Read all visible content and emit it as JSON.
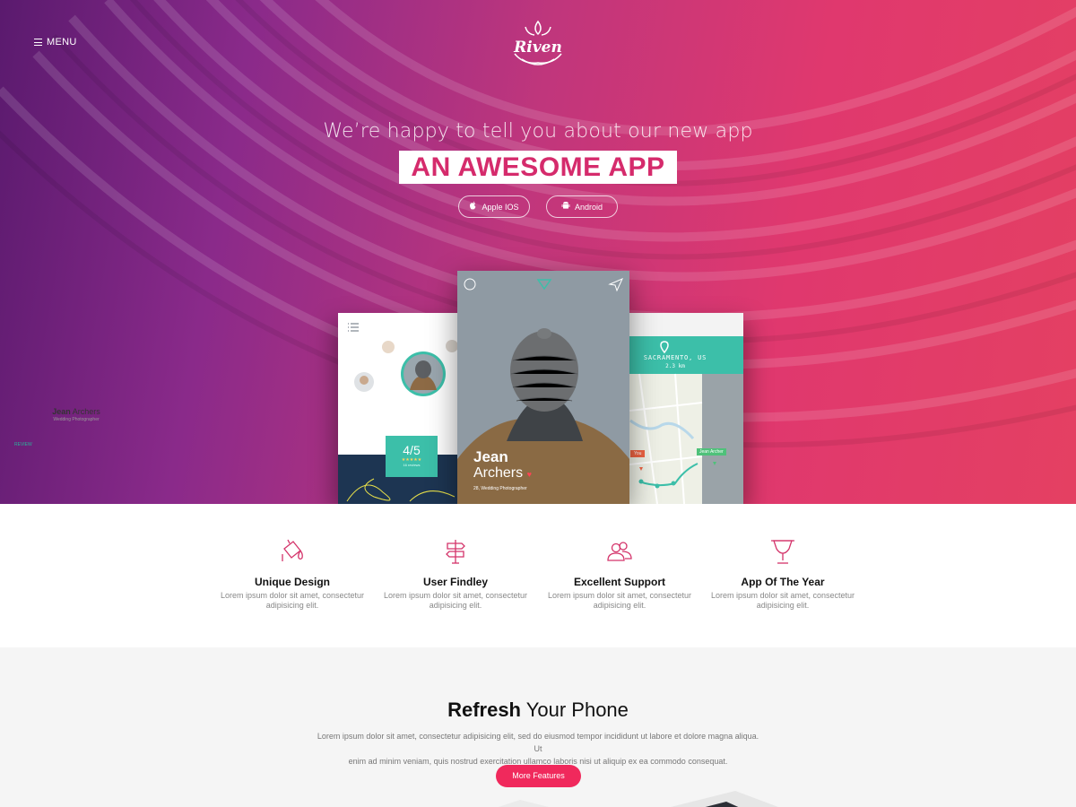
{
  "nav": {
    "menu_label": "MENU",
    "brand": "Riven"
  },
  "hero": {
    "tagline": "We’re happy to tell you about our new app",
    "headline": "AN AWESOME APP",
    "buttons": [
      {
        "label": "Apple IOS",
        "icon": "apple-icon"
      },
      {
        "label": "Android",
        "icon": "android-icon"
      }
    ]
  },
  "phones": {
    "left": {
      "name_bold": "Jean",
      "name_rest": " Archers",
      "job": "Wedding Photographer",
      "review_label": "REVIEW",
      "rating": "4/5",
      "stars": "★★★★★",
      "reviews_count": "16 reviews"
    },
    "center": {
      "first_name": "Jean",
      "last_name": "Archers",
      "heart": "♥",
      "subtitle": "28, Wedding Photographer"
    },
    "right": {
      "city": "SACRAMENTO, US",
      "distance": "2.3 km",
      "pin_you": "You",
      "pin_other": "Jean Archer"
    }
  },
  "features": [
    {
      "icon": "paint-bucket-icon",
      "title": "Unique Design",
      "desc_line1": "Lorem ipsum dolor sit amet, consectetur",
      "desc_line2": "adipisicing elit."
    },
    {
      "icon": "signpost-icon",
      "title": "User Findley",
      "desc_line1": "Lorem ipsum dolor sit amet, consectetur",
      "desc_line2": "adipisicing elit."
    },
    {
      "icon": "users-icon",
      "title": "Excellent Support",
      "desc_line1": "Lorem ipsum dolor sit amet, consectetur",
      "desc_line2": "adipisicing elit."
    },
    {
      "icon": "trophy-icon",
      "title": "App Of The Year",
      "desc_line1": "Lorem ipsum dolor sit amet, consectetur",
      "desc_line2": "adipisicing elit."
    }
  ],
  "refresh": {
    "title_bold": "Refresh",
    "title_rest": " Your Phone",
    "body_line1": "Lorem ipsum dolor sit amet, consectetur adipisicing elit, sed do eiusmod tempor incididunt ut labore et dolore magna aliqua. Ut",
    "body_line2": "enim ad minim veniam, quis nostrud exercitation ullamco laboris nisi ut aliquip ex ea commodo consequat.",
    "button": "More Features"
  },
  "colors": {
    "accent": "#f0295c",
    "headline_text": "#d52b6c",
    "teal": "#3cbfa9",
    "icon_pink": "#d4336a"
  }
}
